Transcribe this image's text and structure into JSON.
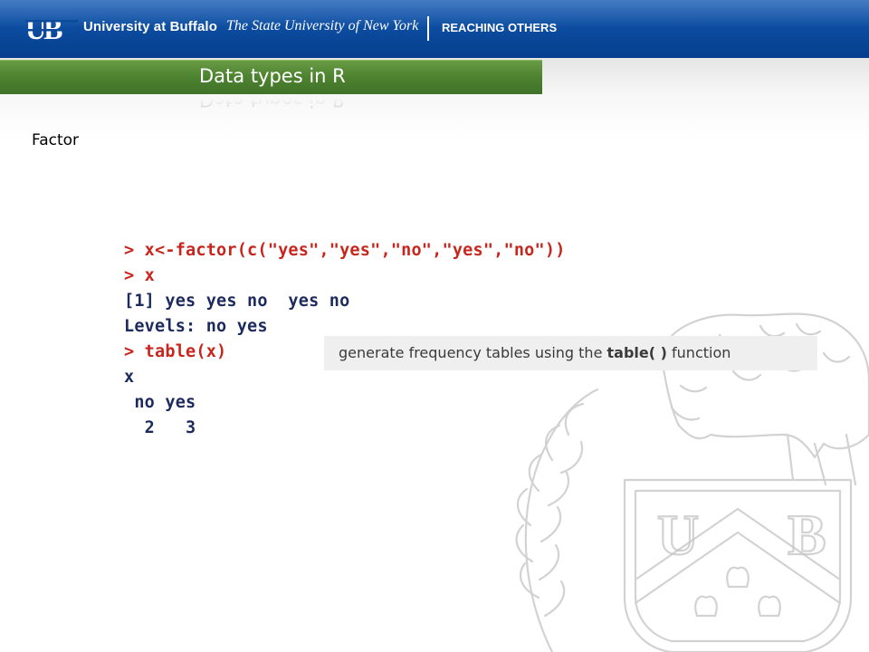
{
  "header": {
    "logo_text": "UB",
    "university": "University at Buffalo",
    "system": "The State University of New York",
    "tagline": "REACHING OTHERS"
  },
  "slide": {
    "title": "Data types in R",
    "section": "Factor"
  },
  "console": {
    "lines": [
      {
        "kind": "cmd",
        "text": "> x<-factor(c(\"yes\",\"yes\",\"no\",\"yes\",\"no\"))"
      },
      {
        "kind": "cmd",
        "text": "> x"
      },
      {
        "kind": "out",
        "text": "[1] yes yes no  yes no"
      },
      {
        "kind": "out",
        "text": "Levels: no yes"
      },
      {
        "kind": "cmd",
        "text": "> table(x)"
      },
      {
        "kind": "out",
        "text": "x"
      },
      {
        "kind": "out",
        "text": " no yes"
      },
      {
        "kind": "out",
        "text": "  2   3"
      }
    ]
  },
  "callout": {
    "prefix": "generate frequency tables using the ",
    "emphasis": "table( )",
    "suffix": " function"
  },
  "watermark": {
    "shield_letters": [
      "U",
      "B"
    ]
  },
  "colors": {
    "banner_blue": "#0b4a9d",
    "title_green": "#4f8431",
    "console_command": "#c8251c",
    "console_output": "#1c2a5e",
    "callout_bg": "#efefef"
  }
}
